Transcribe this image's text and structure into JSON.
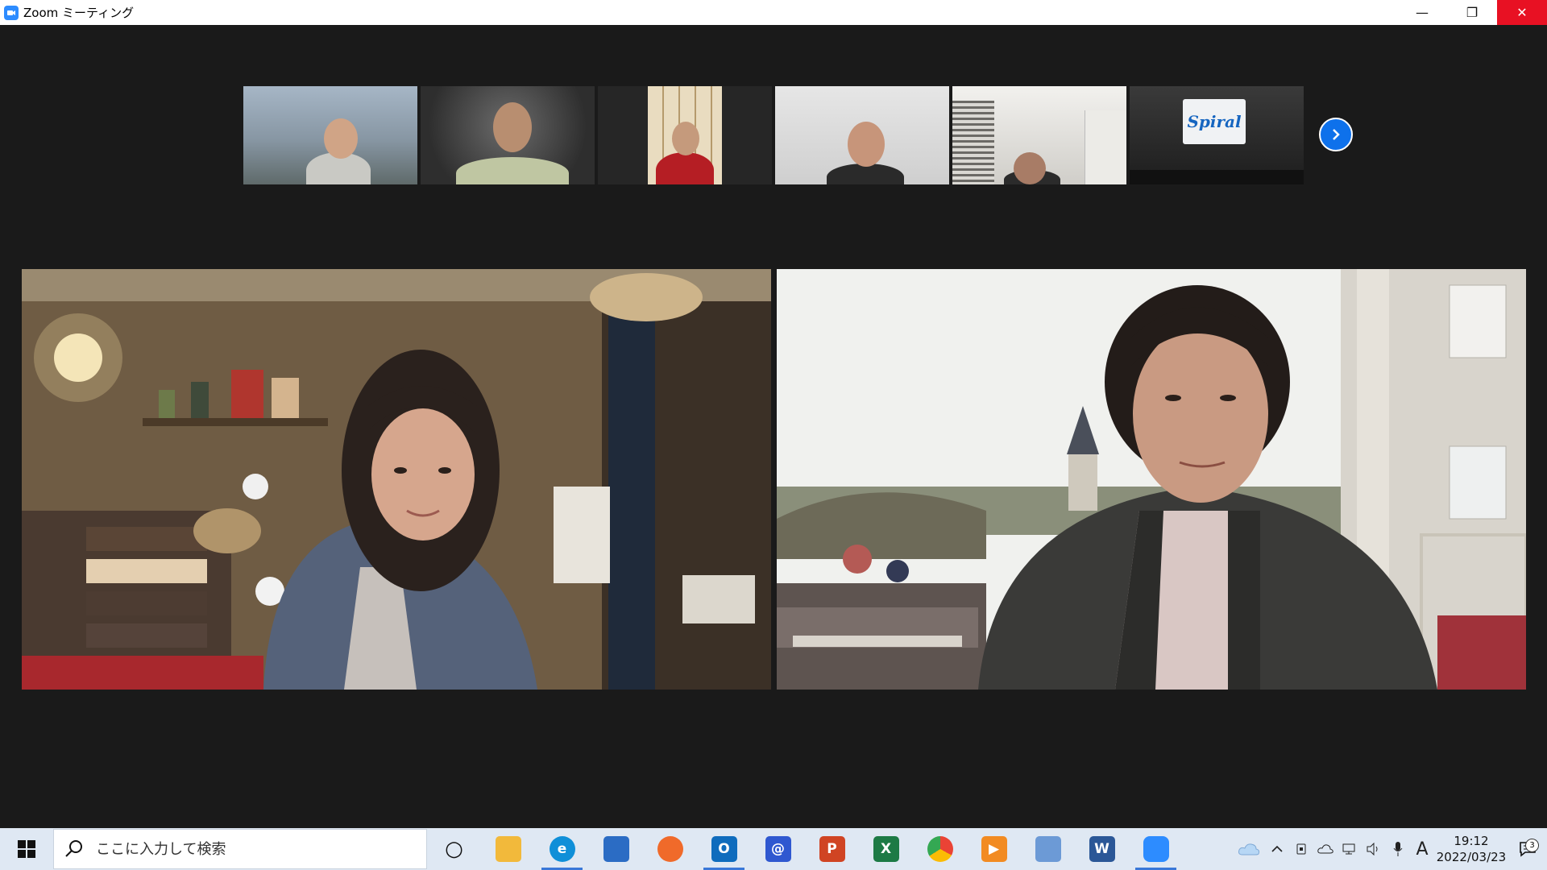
{
  "window": {
    "title": "Zoom ミーティング",
    "controls": {
      "minimize": "—",
      "restore": "❐",
      "close": "✕"
    }
  },
  "thumbnails": [
    {
      "id": "p1",
      "bg": "#8a9aa8"
    },
    {
      "id": "p2",
      "bg": "#4a4a4a"
    },
    {
      "id": "p3",
      "bg": "#d9c9a8"
    },
    {
      "id": "p4",
      "bg": "#dcdcdc"
    },
    {
      "id": "p5",
      "bg": "#d8d6d2"
    },
    {
      "id": "p6",
      "bg": "#2a2a2a",
      "sign": "Spiral"
    }
  ],
  "taskbar": {
    "search_placeholder": "ここに入力して検索",
    "apps": [
      {
        "name": "task-view",
        "label": "○",
        "color": "transparent"
      },
      {
        "name": "file-explorer",
        "label": "",
        "color": "#f2b93b"
      },
      {
        "name": "edge",
        "label": "e",
        "color": "#0f8fd8"
      },
      {
        "name": "store",
        "label": "",
        "color": "#2b6cc4"
      },
      {
        "name": "app-orange",
        "label": "",
        "color": "#f06a2a"
      },
      {
        "name": "outlook",
        "label": "O",
        "color": "#0f6cbd"
      },
      {
        "name": "mail-at",
        "label": "@",
        "color": "#2f58d0"
      },
      {
        "name": "powerpoint",
        "label": "P",
        "color": "#d04423"
      },
      {
        "name": "excel",
        "label": "X",
        "color": "#1d7a45"
      },
      {
        "name": "chrome",
        "label": "",
        "color": "#ea4335"
      },
      {
        "name": "media-player",
        "label": "▶",
        "color": "#f28b22"
      },
      {
        "name": "monitor-app",
        "label": "",
        "color": "#6c9ad6"
      },
      {
        "name": "word",
        "label": "W",
        "color": "#2b5797"
      },
      {
        "name": "zoom",
        "label": "",
        "color": "#2d8cff"
      }
    ],
    "clock_time": "19:12",
    "clock_date": "2022/03/23",
    "ime_label": "A",
    "notification_count": "3"
  }
}
